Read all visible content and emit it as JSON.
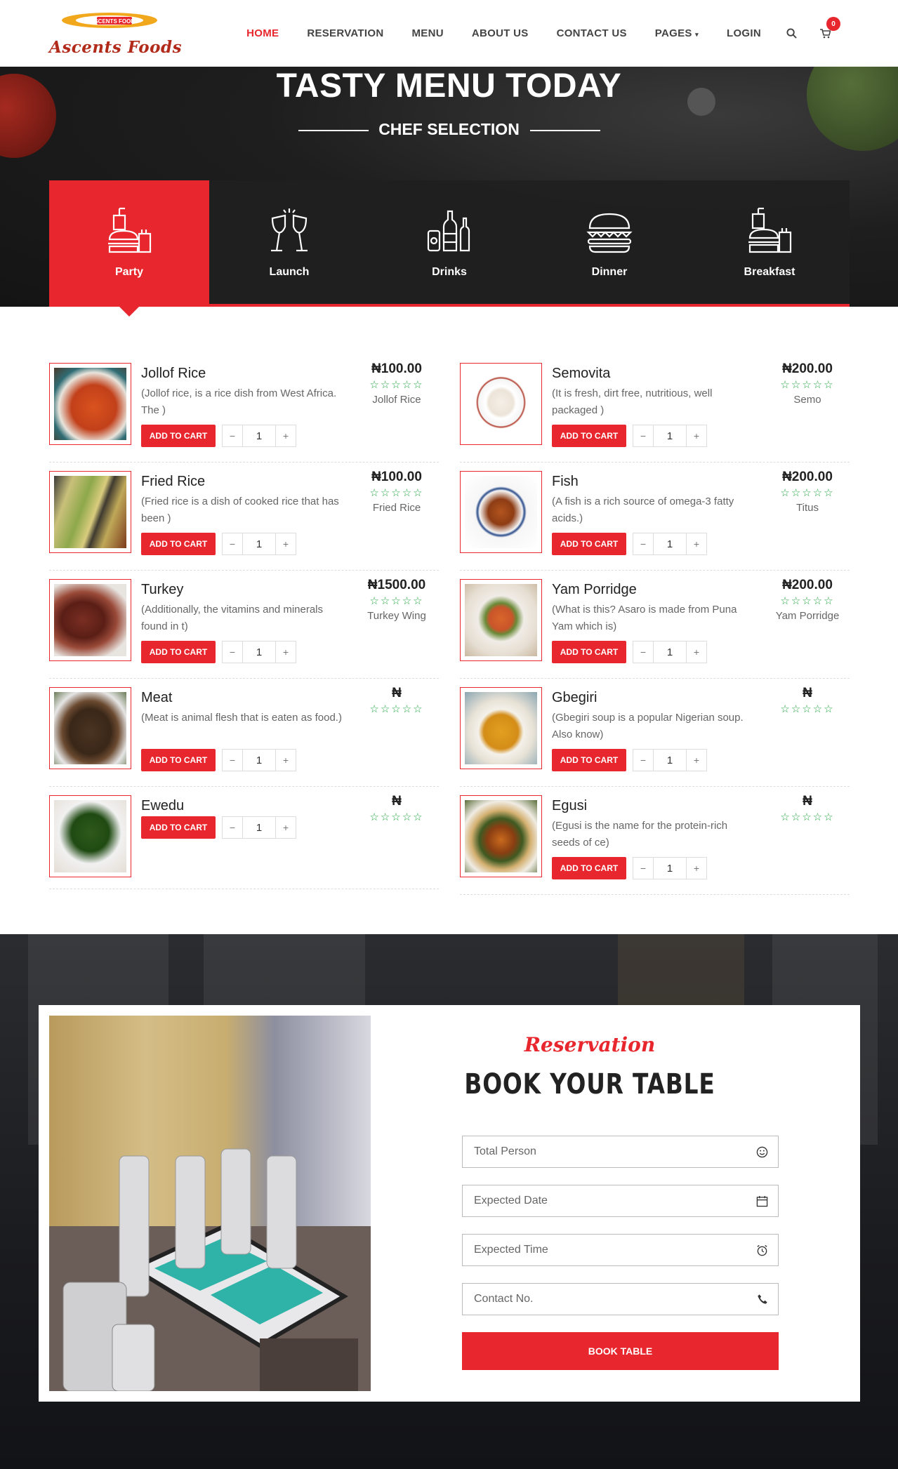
{
  "header": {
    "logo_text": "Ascents Foods",
    "logo_plate_text": "ASCENTS FOODS",
    "nav": [
      "HOME",
      "RESERVATION",
      "MENU",
      "ABOUT US",
      "CONTACT US",
      "PAGES",
      "LOGIN"
    ],
    "active_nav": "HOME",
    "cart_count": "0"
  },
  "hero": {
    "title": "TASTY MENU TODAY",
    "subtitle": "CHEF SELECTION"
  },
  "tabs": [
    {
      "label": "Party",
      "icon": "party-food-icon",
      "active": true
    },
    {
      "label": "Launch",
      "icon": "wine-glasses-icon",
      "active": false
    },
    {
      "label": "Drinks",
      "icon": "bottles-icon",
      "active": false
    },
    {
      "label": "Dinner",
      "icon": "burger-icon",
      "active": false
    },
    {
      "label": "Breakfast",
      "icon": "breakfast-icon",
      "active": false
    }
  ],
  "menu": {
    "add_label": "ADD TO CART",
    "stars": "☆☆☆☆☆",
    "left": [
      {
        "name": "Jollof Rice",
        "desc": "(Jollof rice, is a rice dish from West Africa. The )",
        "price": "₦100.00",
        "tag": "Jollof Rice",
        "qty": "1"
      },
      {
        "name": "Fried Rice",
        "desc": "(Fried rice is a dish of cooked rice that has been )",
        "price": "₦100.00",
        "tag": "Fried Rice",
        "qty": "1"
      },
      {
        "name": "Turkey",
        "desc": "(Additionally, the vitamins and minerals found in t)",
        "price": "₦1500.00",
        "tag": "Turkey Wing",
        "qty": "1"
      },
      {
        "name": "Meat",
        "desc": "(Meat is animal flesh that is eaten as food.)",
        "price": "₦",
        "tag": "",
        "qty": "1"
      },
      {
        "name": "Ewedu",
        "desc": "",
        "price": "₦",
        "tag": "",
        "qty": "1"
      }
    ],
    "right": [
      {
        "name": "Semovita",
        "desc": "(It is fresh, dirt free, nutritious, well packaged )",
        "price": "₦200.00",
        "tag": "Semo",
        "qty": "1"
      },
      {
        "name": "Fish",
        "desc": "(A fish is a rich source of omega-3 fatty acids.)",
        "price": "₦200.00",
        "tag": "Titus",
        "qty": "1"
      },
      {
        "name": "Yam Porridge",
        "desc": "(What is this? Asaro is made from Puna Yam which is)",
        "price": "₦200.00",
        "tag": "Yam Porridge",
        "qty": "1"
      },
      {
        "name": "Gbegiri",
        "desc": "(Gbegiri soup is a popular Nigerian soup. Also know)",
        "price": "₦",
        "tag": "",
        "qty": "1"
      },
      {
        "name": "Egusi",
        "desc": "(Egusi is the name for the protein-rich seeds of ce)",
        "price": "₦",
        "tag": "",
        "qty": "1"
      }
    ]
  },
  "reservation": {
    "script_title": "Reservation",
    "title": "BOOK YOUR TABLE",
    "fields": [
      {
        "placeholder": "Total Person",
        "icon": "smiley-icon"
      },
      {
        "placeholder": "Expected Date",
        "icon": "calendar-icon"
      },
      {
        "placeholder": "Expected Time",
        "icon": "alarm-clock-icon"
      },
      {
        "placeholder": "Contact No.",
        "icon": "phone-icon"
      }
    ],
    "button": "BOOK TABLE"
  },
  "colors": {
    "accent": "#e8262d",
    "dark": "#202020",
    "star": "#28a745"
  }
}
